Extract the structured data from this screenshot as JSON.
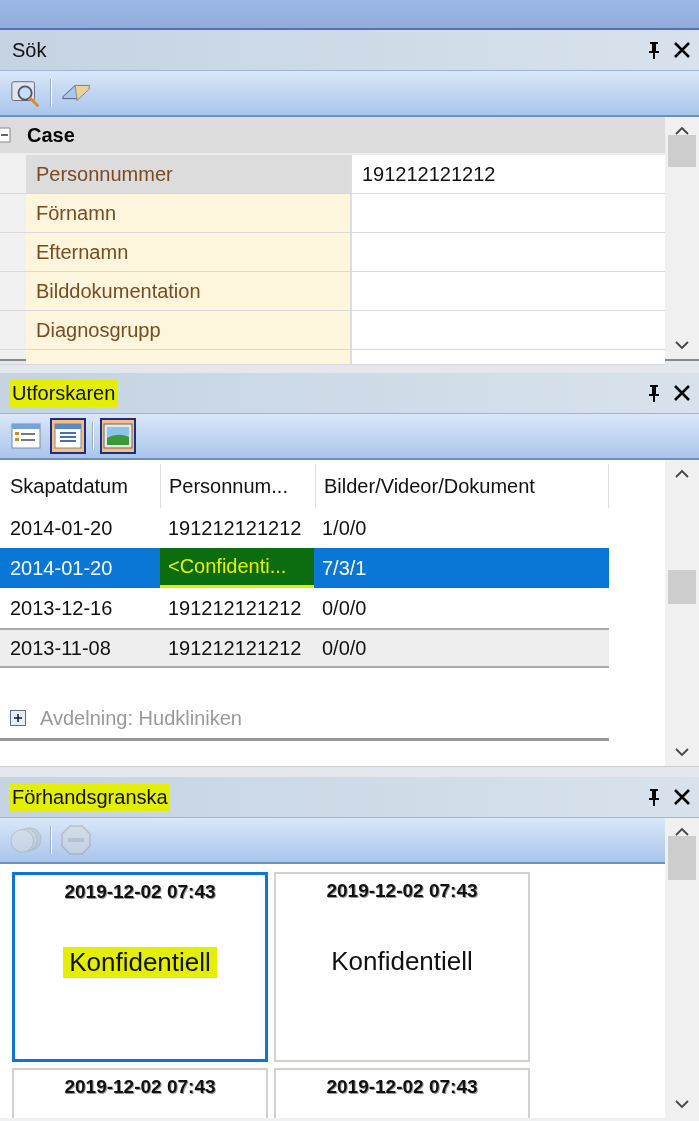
{
  "search_panel": {
    "title": "Sök",
    "category": {
      "label": "Case",
      "expanded": true
    },
    "rows": [
      {
        "label": "Personnummer",
        "value": "191212121212",
        "selected": true
      },
      {
        "label": "Förnamn",
        "value": "",
        "selected": false
      },
      {
        "label": "Efternamn",
        "value": "",
        "selected": false
      },
      {
        "label": "Bilddokumentation",
        "value": "",
        "selected": false
      },
      {
        "label": "Diagnosgrupp",
        "value": "",
        "selected": false
      }
    ]
  },
  "explorer_panel": {
    "title": "Utforskaren",
    "title_highlighted": true,
    "toolbar": [
      {
        "kind": "details",
        "selected": false
      },
      {
        "kind": "list",
        "selected": true
      },
      {
        "kind": "image",
        "selected": true
      }
    ],
    "columns": [
      "Skapatdatum",
      "Personnum...",
      "Bilder/Videor/Dokument"
    ],
    "rows": [
      {
        "selected": false,
        "cells": [
          {
            "text": "2014-01-20",
            "highlighted": false
          },
          {
            "text": "191212121212",
            "highlighted": false
          },
          {
            "text": "1/0/0",
            "highlighted": false
          }
        ]
      },
      {
        "selected": true,
        "cells": [
          {
            "text": "2014-01-20",
            "highlighted": false
          },
          {
            "text": "<Confidenti...",
            "highlighted": true
          },
          {
            "text": "7/3/1",
            "highlighted": false
          }
        ]
      },
      {
        "selected": false,
        "cells": [
          {
            "text": "2013-12-16",
            "highlighted": false
          },
          {
            "text": "191212121212",
            "highlighted": false
          },
          {
            "text": "0/0/0",
            "highlighted": false
          }
        ]
      },
      {
        "selected": false,
        "cells": [
          {
            "text": "2013-11-08",
            "highlighted": false
          },
          {
            "text": "191212121212",
            "highlighted": false
          },
          {
            "text": "0/0/0",
            "highlighted": false
          }
        ]
      }
    ],
    "group": {
      "label": "Avdelning: Hudkliniken",
      "expanded": false
    }
  },
  "preview_panel": {
    "title": "Förhandsgranska",
    "title_highlighted": true,
    "toolbar": [
      {
        "kind": "discs",
        "disabled": true
      },
      {
        "kind": "stop",
        "disabled": true
      }
    ],
    "thumbnails": [
      {
        "date": "2019-12-02 07:43",
        "label": "Konfidentiell",
        "selected": true,
        "highlighted": true
      },
      {
        "date": "2019-12-02 07:43",
        "label": "Konfidentiell",
        "selected": false,
        "highlighted": false
      },
      {
        "date": "2019-12-02 07:43",
        "selected": false
      },
      {
        "date": "2019-12-02 07:43",
        "selected": false
      }
    ]
  }
}
